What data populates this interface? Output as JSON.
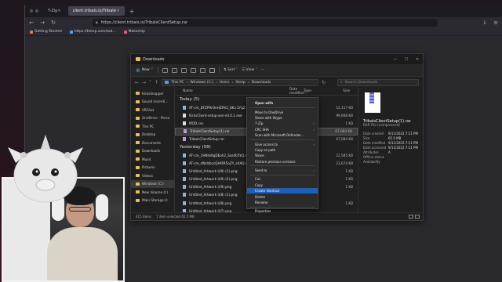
{
  "browser": {
    "tabs": [
      {
        "label": "T-Zip",
        "active": false
      },
      {
        "label": "client.tribals.io/TribalsCli...",
        "active": true
      }
    ],
    "url": "https://client.tribals.io/TribalsClientSetup.rar",
    "bookmarks": [
      "Getting Started",
      "https://bleep.com/tod...",
      "Makeship"
    ]
  },
  "explorer": {
    "title": "Downloads",
    "toolbar": {
      "new_label": "New",
      "sort_label": "Sort",
      "view_label": "View"
    },
    "breadcrumb": [
      "This PC",
      "Windows (C:)",
      "Users",
      "Sleep",
      "Downloads"
    ],
    "search_placeholder": "Search Downloads",
    "columns": [
      "Name",
      "Date modified",
      "Type",
      "Size"
    ],
    "nav_items": [
      {
        "label": "KirksSnapper",
        "selected": false
      },
      {
        "label": "Sound recordi...",
        "selected": false
      },
      {
        "label": "VRChat",
        "selected": false
      },
      {
        "label": "OneDrive - Perso",
        "selected": false
      },
      {
        "label": "This PC",
        "selected": false
      },
      {
        "label": "Desktop",
        "selected": false
      },
      {
        "label": "Documents",
        "selected": false
      },
      {
        "label": "Downloads",
        "selected": false
      },
      {
        "label": "Music",
        "selected": false
      },
      {
        "label": "Pictures",
        "selected": false
      },
      {
        "label": "Videos",
        "selected": false
      },
      {
        "label": "Windows (C:)",
        "selected": true
      },
      {
        "label": "New Volume (I:)",
        "selected": false
      },
      {
        "label": "Main Storage (I:",
        "selected": false
      }
    ],
    "groups": [
      {
        "label": "Today (5)",
        "files": [
          {
            "name": "AT-cm_BFZP9rOnHZfAi2_8Kv.1Yq2...",
            "size": "12,117 KB",
            "kind": "img",
            "selected": false
          },
          {
            "name": "KirksClient-setup-win-v0.0.1.exe",
            "size": "99,668 KB",
            "kind": "exe",
            "selected": false
          },
          {
            "name": "MOD.csv",
            "size": "1 KB",
            "kind": "doc",
            "selected": false
          },
          {
            "name": "TribalsClientSetup(1).rar",
            "size": "67,084 KB",
            "kind": "rar",
            "selected": true
          },
          {
            "name": "TribalsClientSetup.rar",
            "size": "67,084 KB",
            "kind": "rar",
            "selected": false
          }
        ]
      },
      {
        "label": "Yesterday (58)",
        "files": [
          {
            "name": "AT-cm_1HNrb9gDEoh2_Sas0bTkQ.mp4",
            "size": "22,585 KB",
            "kind": "img",
            "selected": false
          },
          {
            "name": "AT-cm_dNzlzbcsQHf4R5oZY_sXAQ.m...",
            "size": "23,674 KB",
            "kind": "img",
            "selected": false
          },
          {
            "name": "Untitled_Artwork (49) (1).png",
            "size": "1 KB",
            "kind": "img",
            "selected": false
          },
          {
            "name": "Untitled_Artwork (49) (2).png",
            "size": "1 KB",
            "kind": "img",
            "selected": false
          },
          {
            "name": "Untitled_Artwork (49).png",
            "size": "1 KB",
            "kind": "img",
            "selected": false
          },
          {
            "name": "Untitled_Artwork (48) (1).png",
            "size": "",
            "kind": "img",
            "selected": false
          },
          {
            "name": "Untitled_Artwork (48).png",
            "size": "1 KB",
            "kind": "img",
            "selected": false
          },
          {
            "name": "Untitled_Artwork (47).png",
            "size": "",
            "kind": "img",
            "selected": false
          }
        ]
      }
    ],
    "preview": {
      "name": "TribalsClientSetup(1).rar",
      "type": "RAR File (compressed)",
      "meta": [
        {
          "key": "Date created",
          "value": "9/11/2022 7:11 PM"
        },
        {
          "key": "Size",
          "value": "65.5 MB"
        },
        {
          "key": "Date modified",
          "value": "9/11/2022 7:11 PM"
        },
        {
          "key": "Date accessed",
          "value": "9/11/2022 7:11 PM"
        },
        {
          "key": "Attributes",
          "value": "A"
        },
        {
          "key": "Offline status",
          "value": ""
        },
        {
          "key": "Availability",
          "value": ""
        }
      ]
    },
    "status": {
      "count": "415 items",
      "selection": "1 item selected  65.5 MB"
    }
  },
  "context_menu": {
    "items": [
      {
        "label": "Open with",
        "bold": true,
        "sub": false
      },
      {
        "label": "Move to OneDrive",
        "bold": false,
        "sub": false
      },
      {
        "label": "Share with Skype",
        "bold": false,
        "sub": false
      },
      {
        "label": "7-Zip",
        "bold": false,
        "sub": true
      },
      {
        "label": "CRC SHA",
        "bold": false,
        "sub": true
      },
      {
        "label": "Scan with Microsoft Defender...",
        "bold": false,
        "sub": false
      },
      {
        "label": "Give access to",
        "bold": false,
        "sub": true
      },
      {
        "label": "Copy as path",
        "bold": false,
        "sub": false
      },
      {
        "label": "Share",
        "bold": false,
        "sub": false
      },
      {
        "label": "Restore previous versions",
        "bold": false,
        "sub": false
      },
      {
        "label": "Send to",
        "bold": false,
        "sub": true
      },
      {
        "label": "Cut",
        "bold": false,
        "sub": false
      },
      {
        "label": "Copy",
        "bold": false,
        "sub": false
      },
      {
        "label": "Create shortcut",
        "bold": false,
        "sub": false,
        "highlight": true
      },
      {
        "label": "Delete",
        "bold": false,
        "sub": false
      },
      {
        "label": "Rename",
        "bold": false,
        "sub": false
      },
      {
        "label": "Properties",
        "bold": false,
        "sub": false
      }
    ]
  },
  "colors": {
    "accent": "#1f5fb8",
    "folder": "#e8c15a",
    "background": "#202020"
  }
}
